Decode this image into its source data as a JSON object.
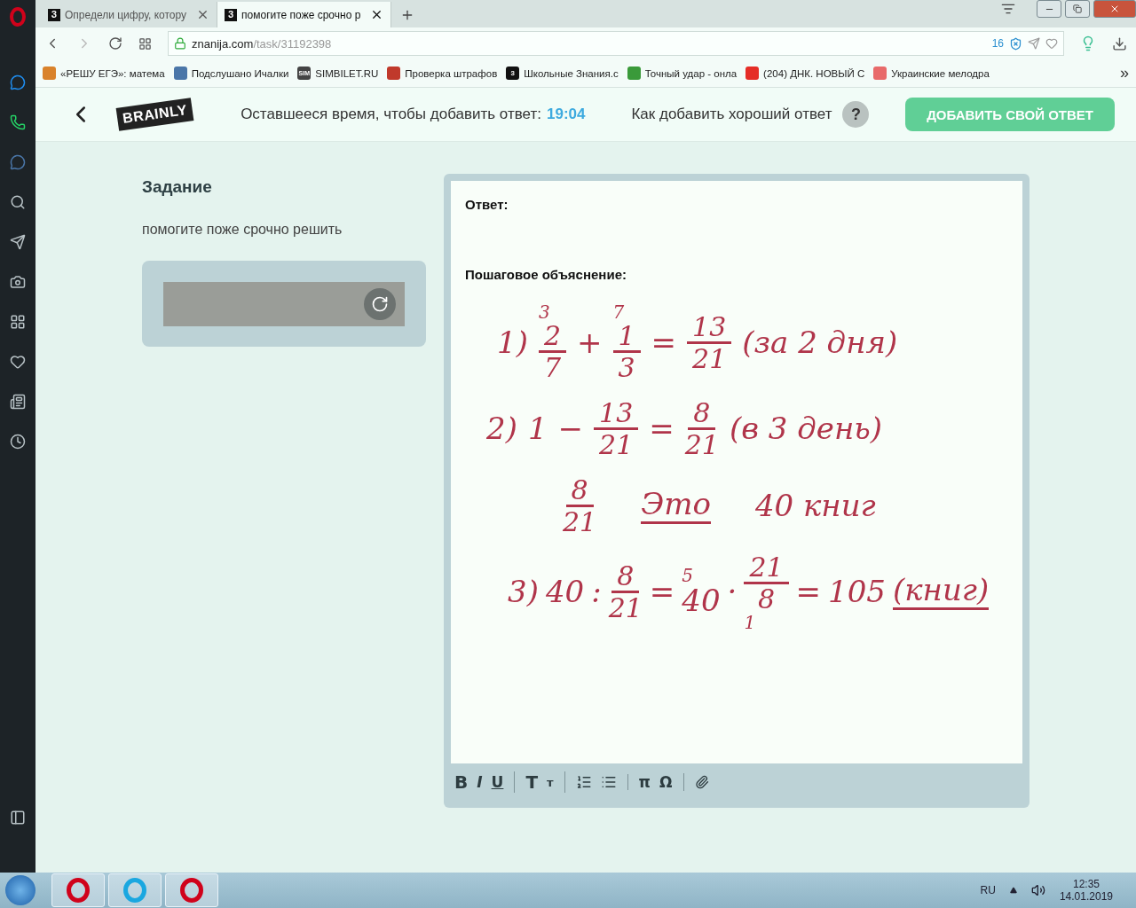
{
  "browser": {
    "tabs": [
      {
        "icon_text": "З",
        "title": "Определи цифру, котору",
        "selected": false
      },
      {
        "icon_text": "З",
        "title": "помогите поже срочно р",
        "selected": true
      }
    ],
    "address": {
      "host": "znanija.com",
      "path": "/task/31192398"
    },
    "blocked_count": "16",
    "bookmarks": [
      {
        "title": "«РЕШУ ЕГЭ»: матема",
        "color": "#d9822b"
      },
      {
        "title": "Подслушано Ичалки",
        "color": "#4a76a8"
      },
      {
        "title": "SIMBILET.RU",
        "icon_text": "SIM",
        "color": "#444444"
      },
      {
        "title": "Проверка штрафов",
        "color": "#c0392b"
      },
      {
        "title": "Школьные Знания.c",
        "icon_text": "З",
        "color": "#111111"
      },
      {
        "title": "Точный удар - онла",
        "color": "#3a9a3a"
      },
      {
        "title": "(204) ДНК. НОВЫЙ С",
        "color": "#e52d27"
      },
      {
        "title": "Украинские мелодра",
        "color": "#e86a6a"
      }
    ],
    "more": "»"
  },
  "header": {
    "logo": "BRAINLY",
    "timer_label": "Оставшееся время, чтобы добавить ответ:",
    "timer_value": "19:04",
    "help_link": "Как добавить хороший ответ",
    "help_icon": "?",
    "add_button": "ДОБАВИТЬ СВОЙ ОТВЕТ"
  },
  "task": {
    "heading": "Задание",
    "text": "помогите поже срочно решить"
  },
  "editor": {
    "answer_label": "Ответ:",
    "explanation_label": "Пошаговое объяснение:",
    "handwriting": [
      [
        {
          "kind": "text",
          "t": "1)"
        },
        {
          "kind": "frac",
          "num": "2",
          "den": "7",
          "note": "3"
        },
        {
          "kind": "text",
          "t": "+"
        },
        {
          "kind": "frac",
          "num": "1",
          "den": "3",
          "note": "7"
        },
        {
          "kind": "text",
          "t": "="
        },
        {
          "kind": "frac",
          "num": "13",
          "den": "21"
        },
        {
          "kind": "text",
          "t": "(за 2 дня)"
        }
      ],
      [
        {
          "kind": "text",
          "t": "2)"
        },
        {
          "kind": "text",
          "t": "1"
        },
        {
          "kind": "text",
          "t": "−"
        },
        {
          "kind": "frac",
          "num": "13",
          "den": "21"
        },
        {
          "kind": "text",
          "t": "="
        },
        {
          "kind": "frac",
          "num": "8",
          "den": "21"
        },
        {
          "kind": "text",
          "t": "(в 3 день)"
        }
      ],
      [
        {
          "kind": "frac",
          "num": "8",
          "den": "21"
        },
        {
          "kind": "text",
          "t": "Это",
          "underline": true
        },
        {
          "kind": "text",
          "t": "40 книг"
        }
      ],
      [
        {
          "kind": "text",
          "t": "3)"
        },
        {
          "kind": "text",
          "t": "40"
        },
        {
          "kind": "text",
          "t": ":"
        },
        {
          "kind": "frac",
          "num": "8",
          "den": "21"
        },
        {
          "kind": "text",
          "t": "="
        },
        {
          "kind": "text",
          "t": "40",
          "note": "5"
        },
        {
          "kind": "text",
          "t": "·"
        },
        {
          "kind": "frac",
          "num": "21",
          "den": "8",
          "subnote": "1"
        },
        {
          "kind": "text",
          "t": "="
        },
        {
          "kind": "text",
          "t": "105"
        },
        {
          "kind": "text",
          "t": "(книг)",
          "underline": true
        }
      ]
    ],
    "toolbar": [
      {
        "kind": "format",
        "items": [
          "B",
          "I",
          "U"
        ]
      },
      {
        "kind": "format",
        "items": [
          "T",
          "т"
        ]
      },
      {
        "kind": "lists"
      },
      {
        "kind": "format",
        "items": [
          "π",
          "Ω"
        ]
      },
      {
        "kind": "attach"
      }
    ]
  },
  "taskbar": {
    "language": "RU",
    "time": "12:35",
    "date": "14.01.2019"
  }
}
